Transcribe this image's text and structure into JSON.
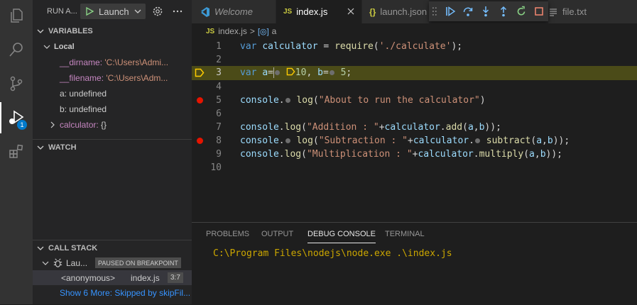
{
  "activity_bar": {
    "icons": [
      "explorer-icon",
      "search-icon",
      "source-control-icon",
      "run-debug-icon",
      "extensions-icon"
    ],
    "debug_badge": "1"
  },
  "sidebar": {
    "run_title": "RUN A...",
    "launch_config": "Launch",
    "variables_header": "VARIABLES",
    "local_header": "Local",
    "variables": [
      {
        "name": "__dirname:",
        "value": "'C:\\Users\\Admi..."
      },
      {
        "name": "__filename:",
        "value": "'C:\\Users\\Adm..."
      },
      {
        "name": "a:",
        "value": "undefined"
      },
      {
        "name": "b:",
        "value": "undefined"
      },
      {
        "name": "calculator:",
        "value": "{}"
      }
    ],
    "watch_header": "WATCH",
    "callstack_header": "CALL STACK",
    "callstack": {
      "thread": "Lau...",
      "status": "PAUSED ON BREAKPOINT",
      "frame": "<anonymous>",
      "file": "index.js",
      "position": "3:7",
      "more": "Show 6 More: Skipped by skipFil..."
    }
  },
  "tabs": [
    {
      "label": "Welcome",
      "icon": "vscode-icon"
    },
    {
      "label": "index.js",
      "icon": "JS",
      "active": true
    },
    {
      "label": "launch.json",
      "icon": "{}"
    },
    {
      "label": "file.txt",
      "icon": "file-icon"
    }
  ],
  "debug_toolbar": {
    "buttons": [
      "continue-icon",
      "step-over-icon",
      "step-into-icon",
      "step-out-icon",
      "restart-icon",
      "stop-icon"
    ]
  },
  "breadcrumb": {
    "file_icon": "JS",
    "file": "index.js",
    "separator": ">",
    "symbol": "a"
  },
  "editor": {
    "current_line": 3,
    "breakpoints": [
      5,
      8
    ],
    "lines": [
      {
        "n": "1"
      },
      {
        "n": "2"
      },
      {
        "n": "3"
      },
      {
        "n": "4"
      },
      {
        "n": "5"
      },
      {
        "n": "6"
      },
      {
        "n": "7"
      },
      {
        "n": "8"
      },
      {
        "n": "9"
      },
      {
        "n": "10"
      }
    ]
  },
  "panel": {
    "tabs": [
      "PROBLEMS",
      "OUTPUT",
      "DEBUG CONSOLE",
      "TERMINAL"
    ],
    "active_tab": "DEBUG CONSOLE",
    "console_output": "C:\\Program Files\\nodejs\\node.exe .\\index.js"
  },
  "colors": {
    "accent": "#007acc",
    "breakpoint": "#e51400",
    "current_line": "#4b4b18",
    "console_text": "#cca700"
  }
}
